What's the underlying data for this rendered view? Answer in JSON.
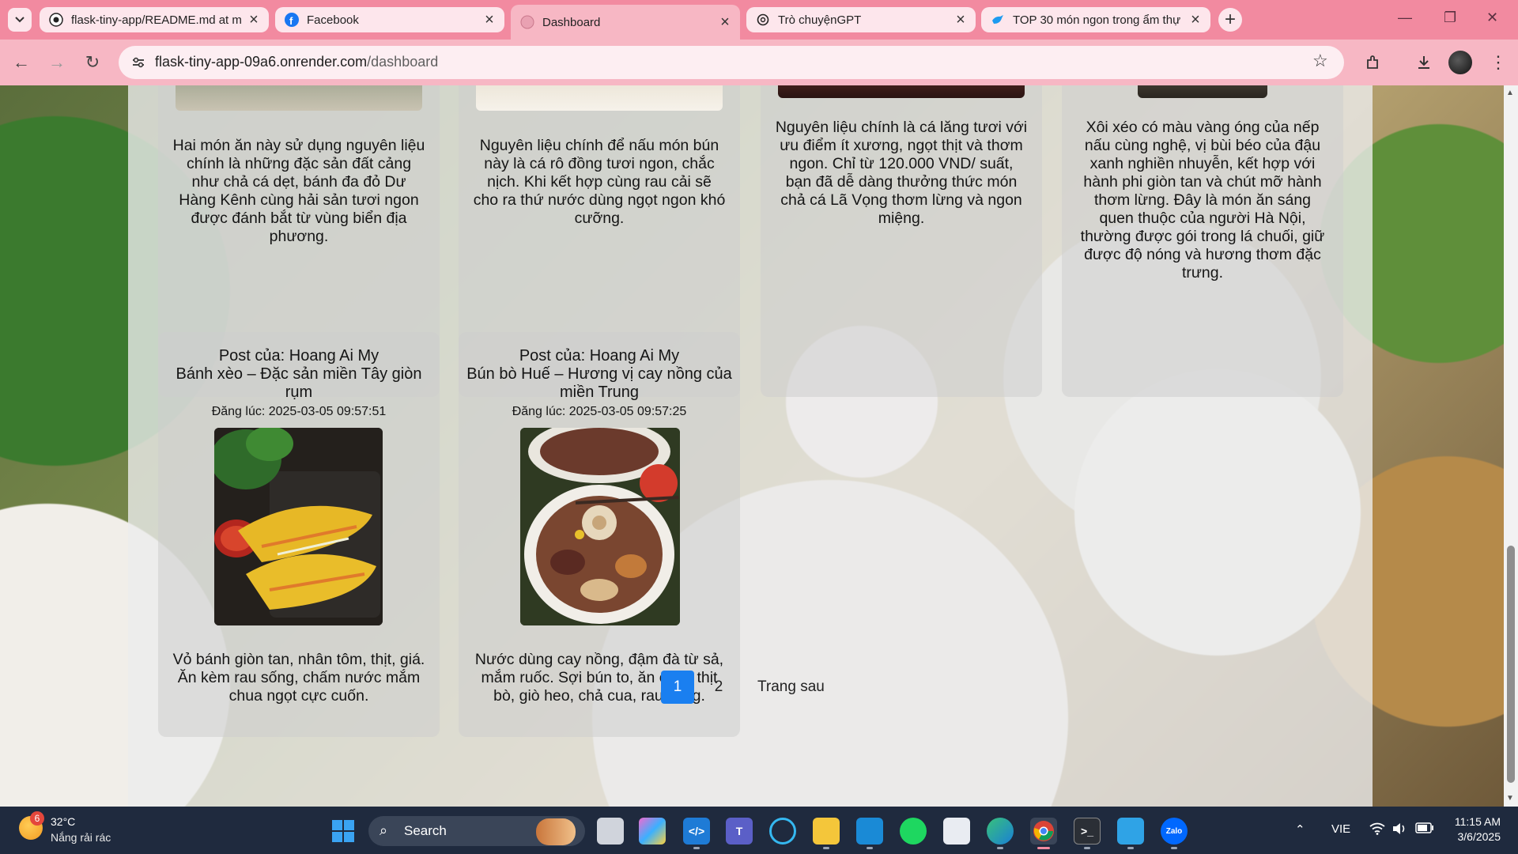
{
  "browser": {
    "tabs": [
      {
        "title": "flask-tiny-app/README.md at m",
        "icon": "github-icon",
        "active": false
      },
      {
        "title": "Facebook",
        "icon": "facebook-icon",
        "active": false
      },
      {
        "title": "Dashboard",
        "icon": "globe-icon",
        "active": true
      },
      {
        "title": "Trò chuyệnGPT",
        "icon": "chatgpt-icon",
        "active": false
      },
      {
        "title": "TOP 30 món ngon trong ẩm thự",
        "icon": "bird-icon",
        "active": false
      }
    ],
    "url_host": "flask-tiny-app-09a6.onrender.com",
    "url_path": "/dashboard"
  },
  "posts_top": [
    {
      "description": "Hai món ăn này sử dụng nguyên liệu chính là những đặc sản đất cảng như chả cá dẹt, bánh đa đỏ Dư Hàng Kênh cùng hải sản tươi ngon được đánh bắt từ vùng biển địa phương."
    },
    {
      "description": "Nguyên liệu chính để nấu món bún này là cá rô đồng tươi ngon, chắc nịch. Khi kết hợp cùng rau cải sẽ cho ra thứ nước dùng ngọt ngon khó cưỡng."
    },
    {
      "description": "Nguyên liệu chính là cá lăng tươi với ưu điểm ít xương, ngọt thịt và thơm ngon. Chỉ từ 120.000 VND/ suất, bạn đã dễ dàng thưởng thức món chả cá Lã Vọng thơm lừng và ngon miệng."
    },
    {
      "description": "Xôi xéo có màu vàng óng của nếp nấu cùng nghệ, vị bùi béo của đậu xanh nghiền nhuyễn, kết hợp với hành phi giòn tan và chút mỡ hành thơm lừng. Đây là món ăn sáng quen thuộc của người Hà Nội, thường được gói trong lá chuối, giữ được độ nóng và hương thơm đặc trưng."
    }
  ],
  "posts_bottom": [
    {
      "author": "Post của: Hoang Ai My",
      "title": "Bánh xèo – Đặc sản miền Tây giòn rụm",
      "posted": "Đăng lúc: 2025-03-05 09:57:51",
      "description": "Vỏ bánh giòn tan, nhân tôm, thịt, giá. Ăn kèm rau sống, chấm nước mắm chua ngọt cực cuốn."
    },
    {
      "author": "Post của: Hoang Ai My",
      "title": "Bún bò Huế – Hương vị cay nồng của miền Trung",
      "posted": "Đăng lúc: 2025-03-05 09:57:25",
      "description": "Nước dùng cay nồng, đậm đà từ sả, mắm ruốc. Sợi bún to, ăn cùng thịt bò, giò heo, chả cua, rau sống."
    }
  ],
  "pagination": {
    "pages": [
      "1",
      "2"
    ],
    "current": "1",
    "next_label": "Trang sau"
  },
  "taskbar": {
    "weather_temp": "32°C",
    "weather_desc": "Nắng rải rác",
    "weather_badge": "6",
    "search_label": "Search",
    "language": "VIE",
    "time": "11:15 AM",
    "date": "3/6/2025"
  },
  "colors": {
    "accent": "#1a7ff0",
    "chrome": "#f7b7c4",
    "tabbar": "#f28aa0"
  }
}
